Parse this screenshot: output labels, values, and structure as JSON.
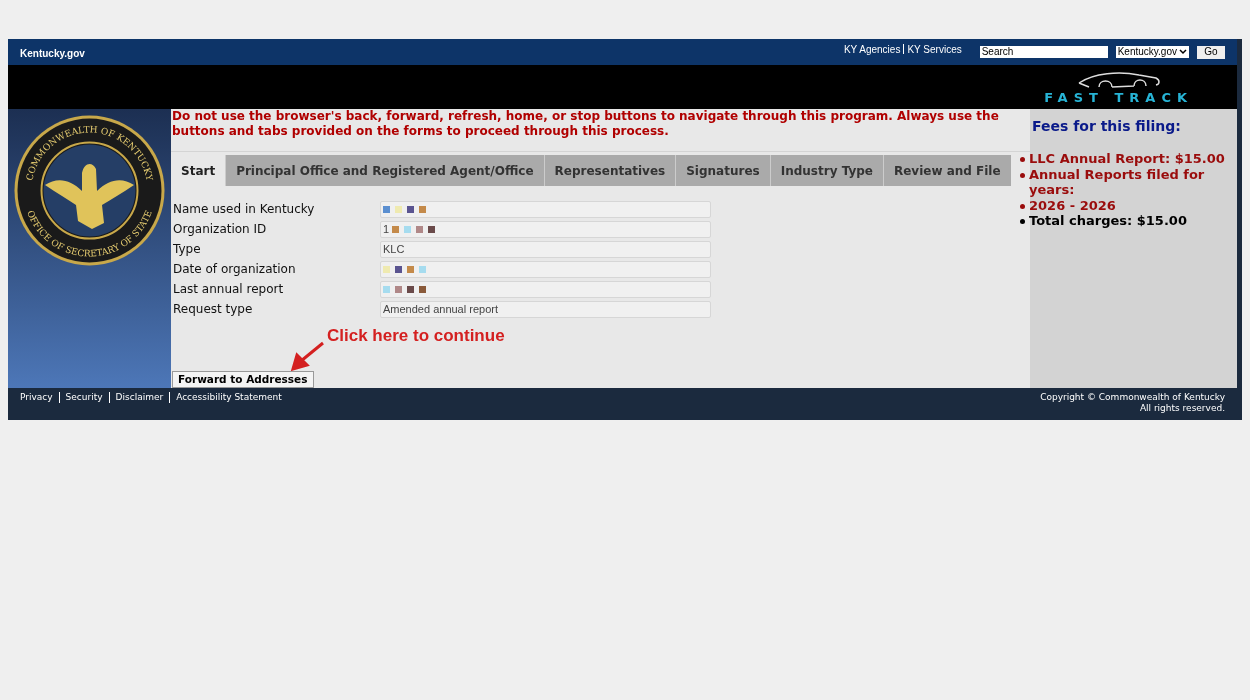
{
  "header": {
    "logo": "Kentucky.gov",
    "links": [
      {
        "label": "KY Agencies"
      },
      {
        "label": "KY Services"
      }
    ],
    "search": {
      "value": "Search"
    },
    "scope_select": {
      "value": "Kentucky.gov"
    },
    "go_button": "Go"
  },
  "brand": {
    "logo_text": "FAST TRACK"
  },
  "seal": {
    "top_text": "COMMONWEALTH OF KENTUCKY",
    "bottom_text": "OFFICE OF SECRETARY OF STATE"
  },
  "warning": "Do not use the browser's back, forward, refresh, home, or stop buttons to navigate through this program.  Always use the buttons and tabs provided on the forms to proceed through this process.",
  "tabs": [
    {
      "label": "Start",
      "selected": true
    },
    {
      "label": "Principal Office and Registered Agent/Office",
      "selected": false
    },
    {
      "label": "Representatives",
      "selected": false
    },
    {
      "label": "Signatures",
      "selected": false
    },
    {
      "label": "Industry Type",
      "selected": false
    },
    {
      "label": "Review and File",
      "selected": false
    }
  ],
  "fields": [
    {
      "label": "Name used in Kentucky",
      "redacted": true
    },
    {
      "label": "Organization ID",
      "value": "1",
      "redacted": true
    },
    {
      "label": "Type",
      "value": "KLC",
      "redacted": false
    },
    {
      "label": "Date of organization",
      "redacted": true
    },
    {
      "label": "Last annual report",
      "redacted": true
    },
    {
      "label": "Request type",
      "value": "Amended annual report",
      "redacted": false
    }
  ],
  "callout": "Click here to continue",
  "forward_button": "Forward to Addresses",
  "fees": {
    "title": "Fees for this filing:",
    "items": [
      {
        "text": "LLC Annual Report: $15.00",
        "kind": "fee"
      },
      {
        "text": "Annual Reports filed for years:",
        "kind": "fee"
      },
      {
        "text": "2026 - 2026",
        "kind": "fee"
      },
      {
        "text": "Total charges: $15.00",
        "kind": "total"
      }
    ]
  },
  "footer": {
    "links": [
      {
        "label": "Privacy"
      },
      {
        "label": "Security"
      },
      {
        "label": "Disclaimer"
      },
      {
        "label": "Accessibility Statement"
      }
    ],
    "copyright": [
      "Copyright © Commonwealth of Kentucky",
      "All rights reserved."
    ]
  }
}
